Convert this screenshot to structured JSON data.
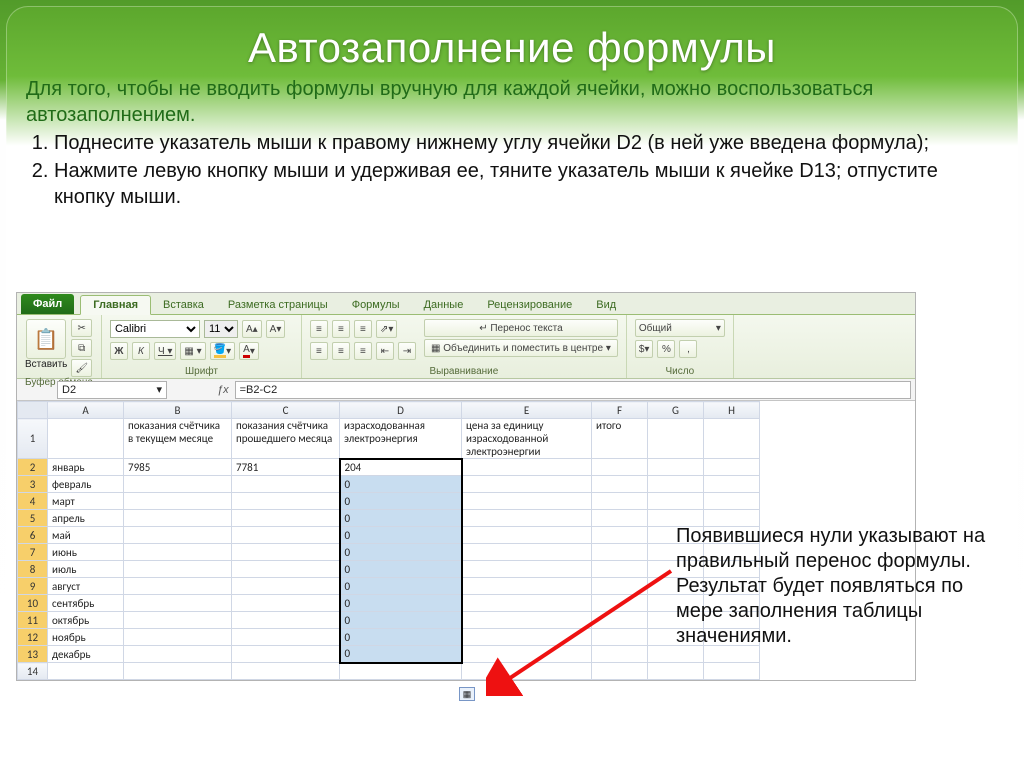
{
  "slide": {
    "title": "Автозаполнение формулы",
    "intro": "Для того, чтобы не вводить формулы вручную для каждой ячейки, можно воспользоваться автозаполнением.",
    "steps": [
      "Поднесите указатель мыши к правому нижнему углу ячейки D2 (в ней уже введена формула);",
      "Нажмите левую кнопку мыши и удерживая ее, тяните указатель мыши к ячейке D13; отпустите кнопку мыши."
    ],
    "callout": "Появившиеся нули указывают на правильный перенос формулы. Результат будет появляться по мере заполнения таблицы значениями."
  },
  "ribbon": {
    "file": "Файл",
    "tabs": [
      "Главная",
      "Вставка",
      "Разметка страницы",
      "Формулы",
      "Данные",
      "Рецензирование",
      "Вид"
    ],
    "active_tab": 0,
    "paste_label": "Вставить",
    "groups": {
      "clipboard": "Буфер обмена",
      "font": "Шрифт",
      "alignment": "Выравнивание",
      "number": "Число"
    },
    "font_name": "Calibri",
    "font_size": "11",
    "wrap_text": "Перенос текста",
    "merge_center": "Объединить и поместить в центре",
    "number_format": "Общий"
  },
  "formula_bar": {
    "name_box": "D2",
    "formula": "=B2-C2"
  },
  "sheet": {
    "columns": [
      "A",
      "B",
      "C",
      "D",
      "E",
      "F",
      "G",
      "H"
    ],
    "headers": {
      "A": "",
      "B": "показания счётчика в текущем месяце",
      "C": "показания счётчика прошедшего месяца",
      "D": "израсходованная электроэнергия",
      "E": "цена за единицу израсходованной электроэнергии",
      "F": "итого"
    },
    "rows": [
      {
        "n": 2,
        "A": "январь",
        "B": "7985",
        "C": "7781",
        "D": "204"
      },
      {
        "n": 3,
        "A": "февраль",
        "D": "0"
      },
      {
        "n": 4,
        "A": "март",
        "D": "0"
      },
      {
        "n": 5,
        "A": "апрель",
        "D": "0"
      },
      {
        "n": 6,
        "A": "май",
        "D": "0"
      },
      {
        "n": 7,
        "A": "июнь",
        "D": "0"
      },
      {
        "n": 8,
        "A": "июль",
        "D": "0"
      },
      {
        "n": 9,
        "A": "август",
        "D": "0"
      },
      {
        "n": 10,
        "A": "сентябрь",
        "D": "0"
      },
      {
        "n": 11,
        "A": "октябрь",
        "D": "0"
      },
      {
        "n": 12,
        "A": "ноябрь",
        "D": "0"
      },
      {
        "n": 13,
        "A": "декабрь",
        "D": "0"
      },
      {
        "n": 14
      }
    ],
    "selection": {
      "col": "D",
      "from": 2,
      "to": 13
    }
  }
}
